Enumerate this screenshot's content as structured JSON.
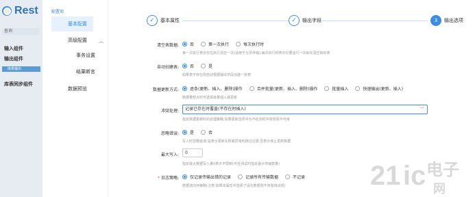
{
  "background": {
    "logo_text": "Rest",
    "search_placeholder": "查询",
    "items": [
      "输入组件",
      "输出组件",
      "库表同步组件"
    ],
    "selected_bar": "库表输出"
  },
  "sidebar": {
    "section_title": "配置项",
    "items": [
      "基本配置",
      "高级配置",
      "事务设置",
      "结果断言",
      "数据预览"
    ]
  },
  "steps": [
    {
      "label": "基本属性",
      "state": "done",
      "mark": "✓"
    },
    {
      "label": "输出字段",
      "state": "done",
      "mark": "✓"
    },
    {
      "label": "输出选项",
      "state": "active",
      "mark": "3"
    }
  ],
  "form": {
    "clear_table": {
      "label": "清空表数据:",
      "options": [
        "否",
        "第一次执行",
        "每次执行时"
      ],
      "selected": 0,
      "hint": "第一次执行表示仅在执行清空一次(适用于分页传输),每次执行时表示只要运行一次就先清空目标表"
    },
    "auto_create": {
      "label": "自动创建表:",
      "options": [
        "否",
        "是"
      ],
      "selected": 0,
      "hint": "如果表不存在则自动根据输出字段创建一张表"
    },
    "update_mode": {
      "label": "数据更新方式:",
      "options": [
        "逐条(更新、插入、删除)操作",
        "合并批量(更新、插入、删除)操作",
        "批量插入",
        "快速输出(更新、插入)"
      ],
      "selected": 0,
      "hint": "数据量较大时可选择批量插入或更新"
    },
    "conflict": {
      "label": "冲突处理:",
      "value": "记录已存在时覆盖(不存在时插入)",
      "hint": "指定数据更新时的处理策略,如果更新选项中为不检测时冲突规则不可用"
    },
    "ignore_error": {
      "label": "忽略错误:",
      "options": [
        "是",
        "否"
      ],
      "selected": 0,
      "hint": "写入时忽略错误,是表示更新失败或异常时跳过记录,否表示停止更新数据"
    },
    "max_write": {
      "label": "最大写入:",
      "value": "0",
      "hint": "指定最大数据写入量0表示不限制(可在测试时指定最大传输数量)"
    },
    "log": {
      "label": "日志策略:",
      "options": [
        "仅记录传输出错的记录",
        "记录所有传输数据",
        "不记录"
      ],
      "selected": 0,
      "hint": "数据流向存策略(注意:如果本属性中选择了请勿数据则不单独将出现)"
    }
  },
  "watermark": {
    "text": "21ic电子网",
    "sub": "www.21ic.com"
  }
}
